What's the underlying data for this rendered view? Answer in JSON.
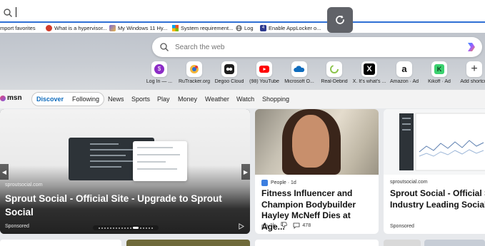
{
  "address_bar": {
    "value": "",
    "placeholder": ""
  },
  "favorites": [
    {
      "label": "mport favorites",
      "color": "#5c5c5c"
    },
    {
      "label": "What is a hypervisor...",
      "color": "#d23b2a"
    },
    {
      "label": "My Windows 11 Hy...",
      "color": "#7a6bd6"
    },
    {
      "label": "System requirement...",
      "color": "#f25022"
    },
    {
      "label": "Log",
      "color": "#444444"
    },
    {
      "label": "Enable AppLocker o...",
      "color": "#2f3b8f"
    }
  ],
  "search": {
    "placeholder": "Search the web"
  },
  "quick_links": [
    {
      "label": "Log In — ...",
      "icon": "skrill-icon",
      "color": "#8c2cc6"
    },
    {
      "label": "RuTracker.org",
      "icon": "rutracker-icon",
      "color": "#2a6fd6"
    },
    {
      "label": "Degoo Cloud",
      "icon": "degoo-icon",
      "color": "#1e1e1e"
    },
    {
      "label": "(98) YouTube",
      "icon": "youtube-icon",
      "color": "#ff0000"
    },
    {
      "label": "Microsoft O...",
      "icon": "onedrive-icon",
      "color": "#0f6cbd"
    },
    {
      "label": "Real-Debrid",
      "icon": "realdebrid-icon",
      "color": "#8bc34a"
    },
    {
      "label": "X. It's what's ...",
      "icon": "x-icon",
      "color": "#000000"
    },
    {
      "label": "Amazon · Ad",
      "icon": "amazon-icon",
      "color": "#111111"
    },
    {
      "label": "Kikoff · Ad",
      "icon": "kikoff-icon",
      "color": "#3bd16f"
    },
    {
      "label": "Add shortcut",
      "icon": "plus-icon",
      "color": "#333333"
    }
  ],
  "msn": {
    "logo": "msn",
    "tabs": [
      "Discover",
      "Following"
    ],
    "links": [
      "News",
      "Sports",
      "Play",
      "Money",
      "Weather",
      "Watch",
      "Shopping"
    ]
  },
  "cards": {
    "carousel": {
      "source": "sproutsocial.com",
      "title": "Sprout Social - Official Site - Upgrade to Sprout Social",
      "sponsored": "Sponsored"
    },
    "news": {
      "source": "People · 1d",
      "title": "Fitness Influencer and Champion Bodybuilder Hayley McNeff Dies at Age...",
      "likes": "1k",
      "comments": "478"
    },
    "sprout2": {
      "source": "sproutsocial.com",
      "title": "Sprout Social - Official Site",
      "subtitle": "Industry Leading Social To",
      "sponsored": "Sponsored"
    }
  }
}
